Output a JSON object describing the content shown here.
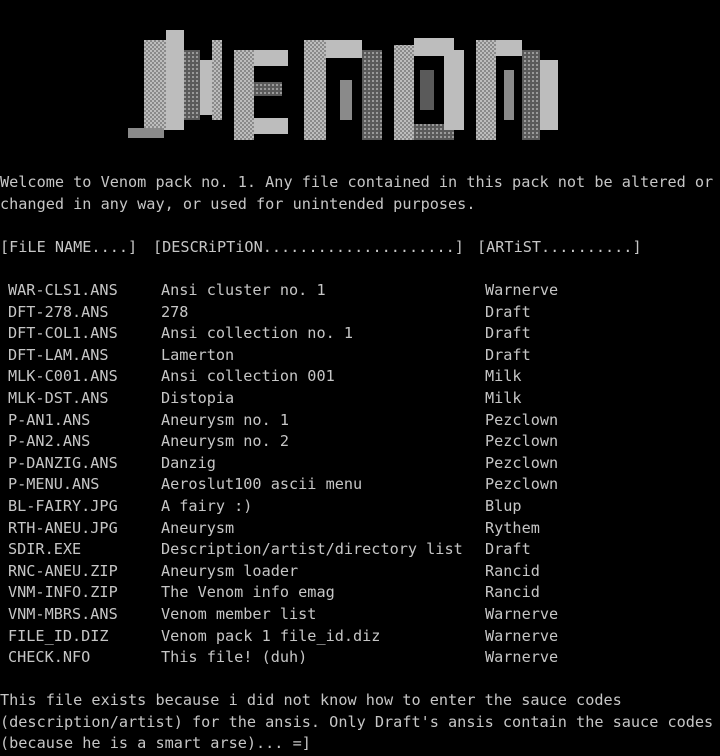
{
  "colors": {
    "background": "#000000",
    "text": "#c6c6c6",
    "logo_light": "#bdbdbd",
    "logo_mid": "#8a8a8a",
    "logo_dark": "#5a5a5a"
  },
  "logo": {
    "text": "VENOM"
  },
  "intro": {
    "line1": "Welcome to Venom pack no. 1. Any file contained in this pack not be altered or",
    "line2": "changed in any way, or used for unintended purposes."
  },
  "header": {
    "file": "[FiLE NAME....]",
    "desc": "[DESCRiPTiON.....................]",
    "artist": "[ARTiST..........]"
  },
  "files": [
    {
      "name": "WAR-CLS1.ANS",
      "desc": "Ansi cluster no. 1",
      "artist": "Warnerve"
    },
    {
      "name": "DFT-278.ANS",
      "desc": "278",
      "artist": "Draft"
    },
    {
      "name": "DFT-COL1.ANS",
      "desc": "Ansi collection no. 1",
      "artist": "Draft"
    },
    {
      "name": "DFT-LAM.ANS",
      "desc": "Lamerton",
      "artist": "Draft"
    },
    {
      "name": "MLK-C001.ANS",
      "desc": "Ansi collection 001",
      "artist": "Milk"
    },
    {
      "name": "MLK-DST.ANS",
      "desc": "Distopia",
      "artist": "Milk"
    },
    {
      "name": "P-AN1.ANS",
      "desc": "Aneurysm no. 1",
      "artist": "Pezclown"
    },
    {
      "name": "P-AN2.ANS",
      "desc": "Aneurysm no. 2",
      "artist": "Pezclown"
    },
    {
      "name": "P-DANZIG.ANS",
      "desc": "Danzig",
      "artist": "Pezclown"
    },
    {
      "name": "P-MENU.ANS",
      "desc": "Aeroslut100 ascii menu",
      "artist": "Pezclown"
    },
    {
      "name": "BL-FAIRY.JPG",
      "desc": "A fairy :)",
      "artist": "Blup"
    },
    {
      "name": "RTH-ANEU.JPG",
      "desc": "Aneurysm",
      "artist": "Rythem"
    },
    {
      "name": "SDIR.EXE",
      "desc": "Description/artist/directory list",
      "artist": "Draft"
    },
    {
      "name": "RNC-ANEU.ZIP",
      "desc": "Aneurysm loader",
      "artist": "Rancid"
    },
    {
      "name": "VNM-INFO.ZIP",
      "desc": "The Venom info emag",
      "artist": "Rancid"
    },
    {
      "name": "VNM-MBRS.ANS",
      "desc": "Venom member list",
      "artist": "Warnerve"
    },
    {
      "name": "FILE_ID.DIZ",
      "desc": "Venom pack 1 file_id.diz",
      "artist": "Warnerve"
    },
    {
      "name": "CHECK.NFO",
      "desc": "This file! (duh)",
      "artist": "Warnerve"
    }
  ],
  "footer": {
    "line1": "This file exists because i did not know how to enter the sauce codes",
    "line2": "(description/artist) for the ansis. Only Draft's ansis contain the sauce codes",
    "line3": "(because he is a smart arse)... =]"
  }
}
